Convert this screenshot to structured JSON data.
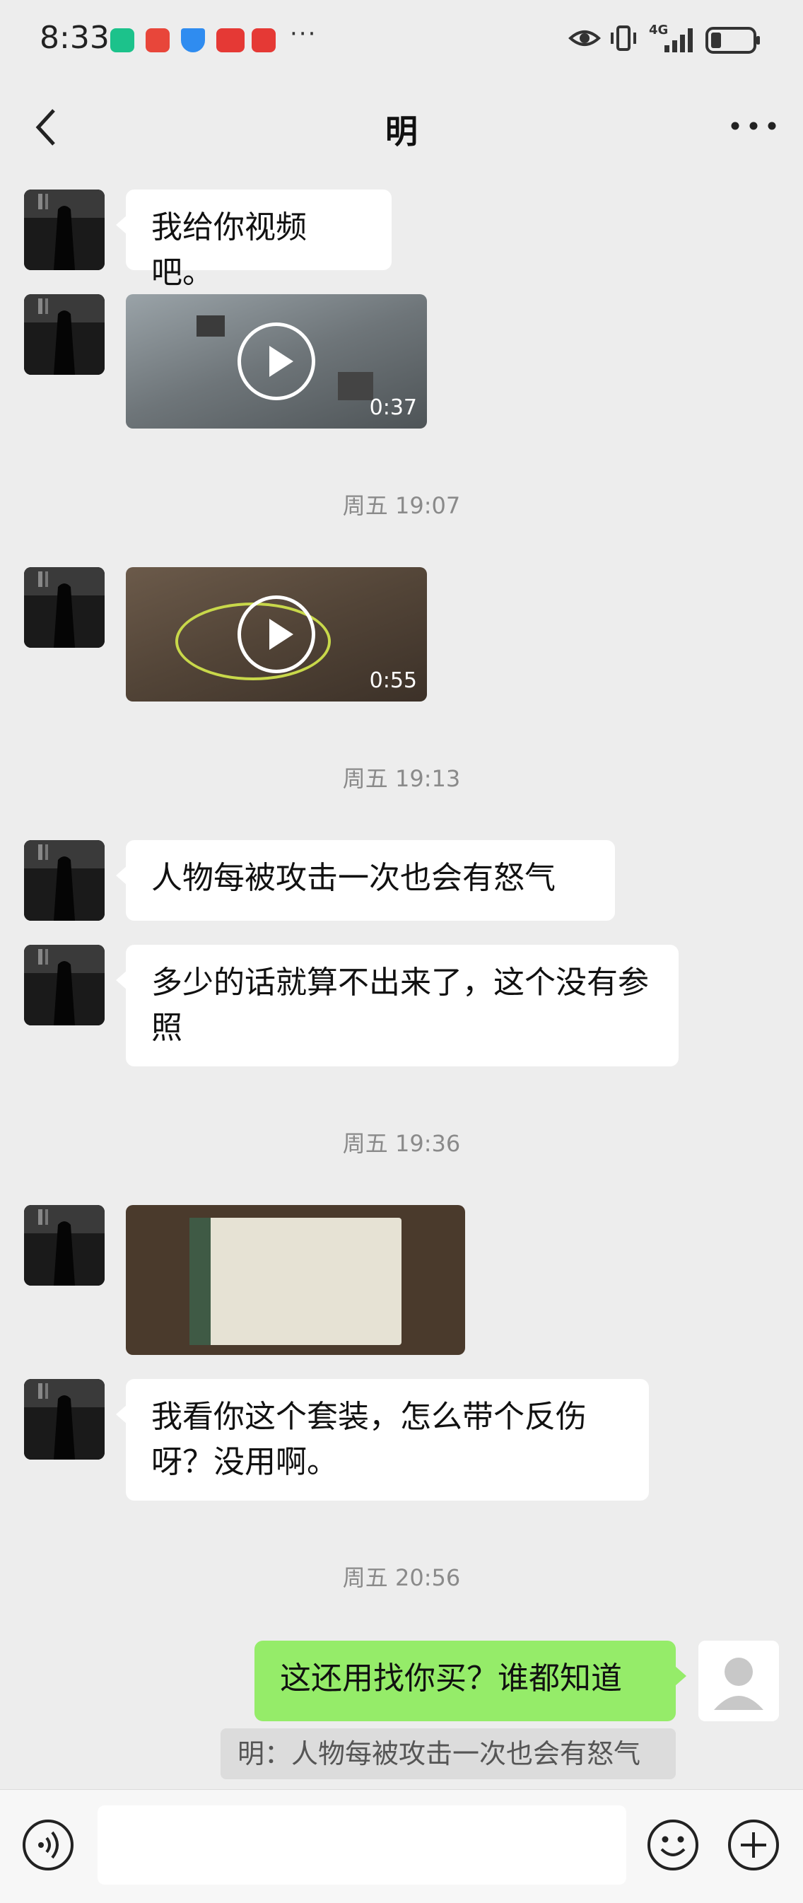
{
  "status_bar": {
    "time": "8:33",
    "more_notifications": "···",
    "network_label": "4G"
  },
  "header": {
    "title": "明"
  },
  "messages": {
    "m1": "我给你视频吧。",
    "video1_duration": "0:37",
    "ts1": "周五 19:07",
    "video2_duration": "0:55",
    "ts2": "周五 19:13",
    "m2": "人物每被攻击一次也会有怒气",
    "m3": "多少的话就算不出来了，这个没有参照",
    "ts3": "周五 19:36",
    "m4": "我看你这个套装，怎么带个反伤呀？没用啊。",
    "ts4": "周五 20:56",
    "my_msg": "这还用找你买？谁都知道",
    "quote": "明：人物每被攻击一次也会有怒气"
  },
  "colors": {
    "background": "#ededed",
    "my_bubble": "#95ec69",
    "their_bubble": "#ffffff"
  },
  "icons": [
    "back-arrow-icon",
    "more-dots-icon",
    "voice-icon",
    "emoji-icon",
    "plus-icon",
    "play-icon"
  ]
}
